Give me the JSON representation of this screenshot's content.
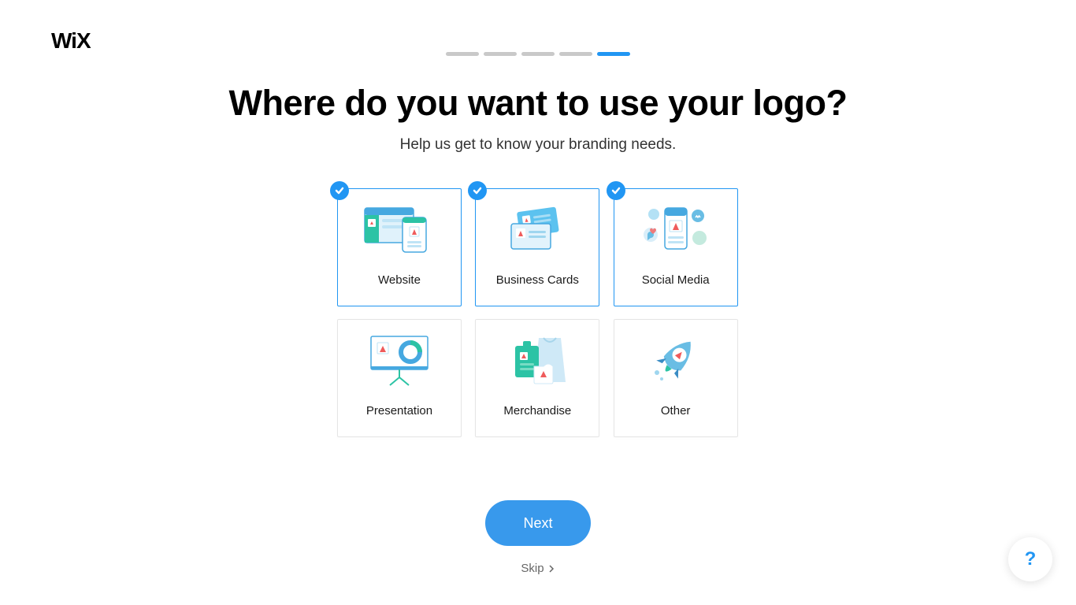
{
  "brand": "WiX",
  "progress": {
    "total": 5,
    "current": 5
  },
  "heading": "Where do you want to use your logo?",
  "subheading": "Help us get to know your branding needs.",
  "options": [
    {
      "key": "website",
      "label": "Website",
      "selected": true
    },
    {
      "key": "business-cards",
      "label": "Business Cards",
      "selected": true
    },
    {
      "key": "social-media",
      "label": "Social Media",
      "selected": true
    },
    {
      "key": "presentation",
      "label": "Presentation",
      "selected": false
    },
    {
      "key": "merchandise",
      "label": "Merchandise",
      "selected": false
    },
    {
      "key": "other",
      "label": "Other",
      "selected": false
    }
  ],
  "actions": {
    "next": "Next",
    "skip": "Skip"
  },
  "help": "?"
}
